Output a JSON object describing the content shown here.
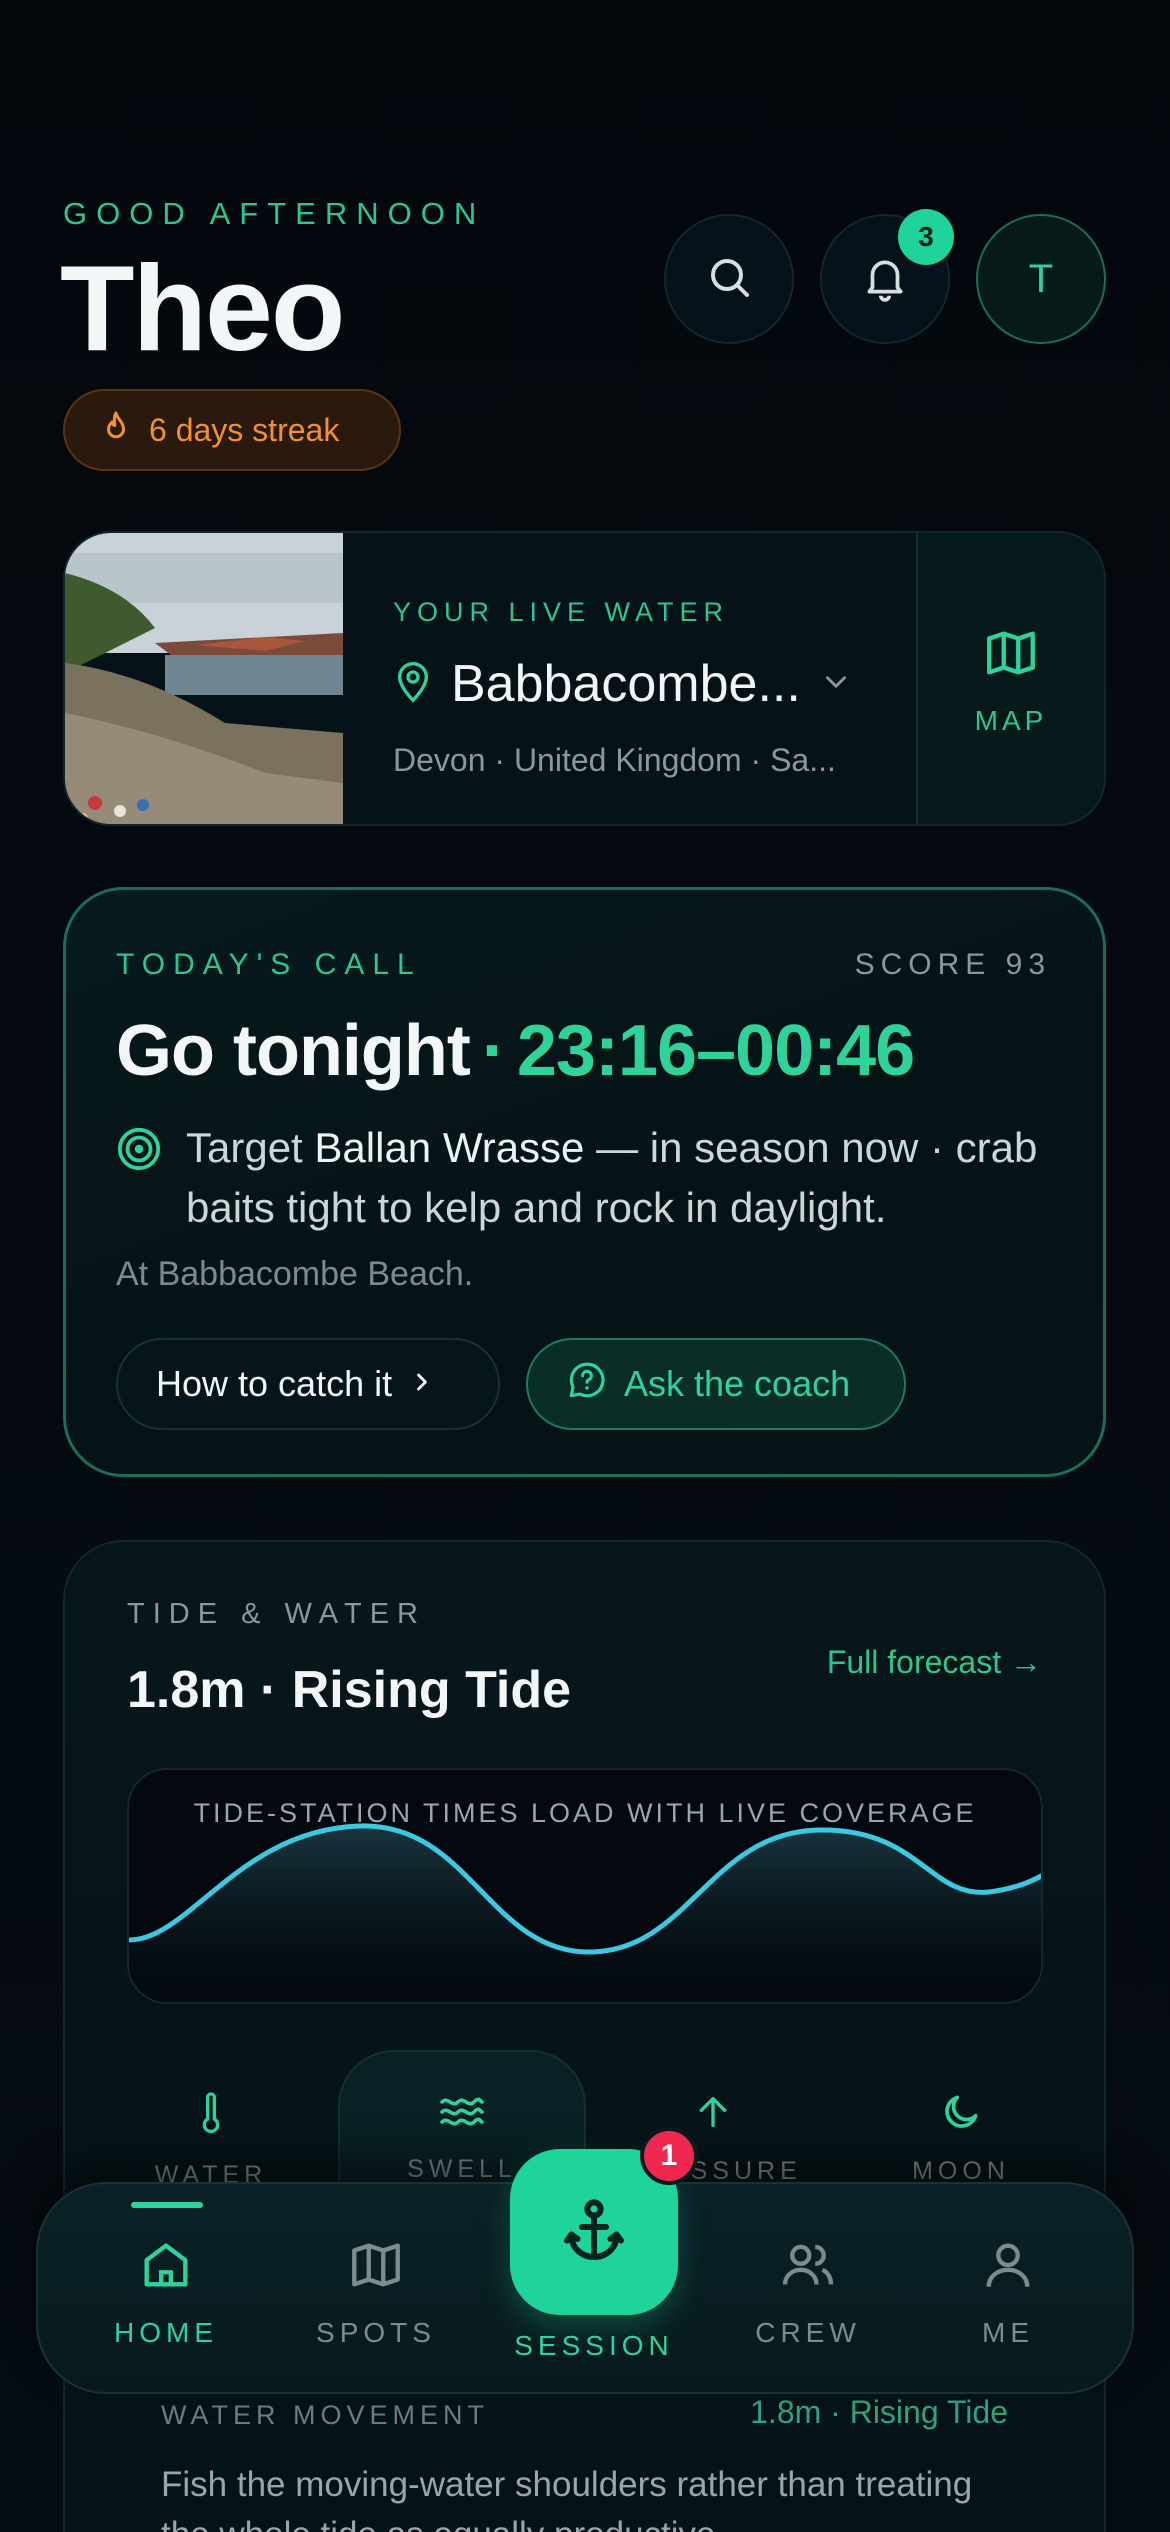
{
  "header": {
    "greeting": "GOOD AFTERNOON",
    "name": "Theo",
    "streak": "6 days streak",
    "notification_count": "3",
    "avatar_initial": "T"
  },
  "live_water": {
    "eyebrow": "YOUR LIVE WATER",
    "name": "Babbacombe...",
    "sub": "Devon · United Kingdom · Sa...",
    "map_label": "MAP"
  },
  "todays_call": {
    "eyebrow": "TODAY'S CALL",
    "score": "SCORE 93",
    "headline": "Go tonight",
    "separator": "·",
    "window": "23:16–00:46",
    "target_prefix": "Target ",
    "target_species": "Ballan Wrasse",
    "target_suffix": " — in season now · crab baits tight to kelp and rock in daylight.",
    "location": "At Babbacombe Beach.",
    "how_label": "How to catch it",
    "coach_label": "Ask the coach"
  },
  "tide": {
    "eyebrow": "TIDE & WATER",
    "title": "1.8m · Rising Tide",
    "link": "Full forecast →",
    "chart_note": "TIDE-STATION TIMES LOAD WITH LIVE COVERAGE",
    "metrics": [
      {
        "label": "WATER",
        "icon": "thermometer-icon"
      },
      {
        "label": "SWELL",
        "icon": "waves-icon"
      },
      {
        "label": "PRESSURE",
        "icon": "arrow-up-icon"
      },
      {
        "label": "MOON",
        "icon": "moon-icon"
      }
    ],
    "movement_eyebrow": "WATER MOVEMENT",
    "movement_value": "1.8m · Rising Tide",
    "movement_text": "Fish the moving-water shoulders rather than treating the whole tide as equally productive."
  },
  "nav": {
    "items": [
      {
        "label": "HOME",
        "icon": "home-icon"
      },
      {
        "label": "SPOTS",
        "icon": "map-icon"
      },
      {
        "label": "SESSION",
        "icon": "anchor-icon"
      },
      {
        "label": "CREW",
        "icon": "users-icon"
      },
      {
        "label": "ME",
        "icon": "user-icon"
      }
    ],
    "session_badge": "1"
  },
  "colors": {
    "accent": "#2fd39a",
    "accent_dark": "#1fd49b",
    "streak": "#f4912c",
    "badge_red": "#f0284f",
    "tide_line": "#3cc8e0"
  }
}
